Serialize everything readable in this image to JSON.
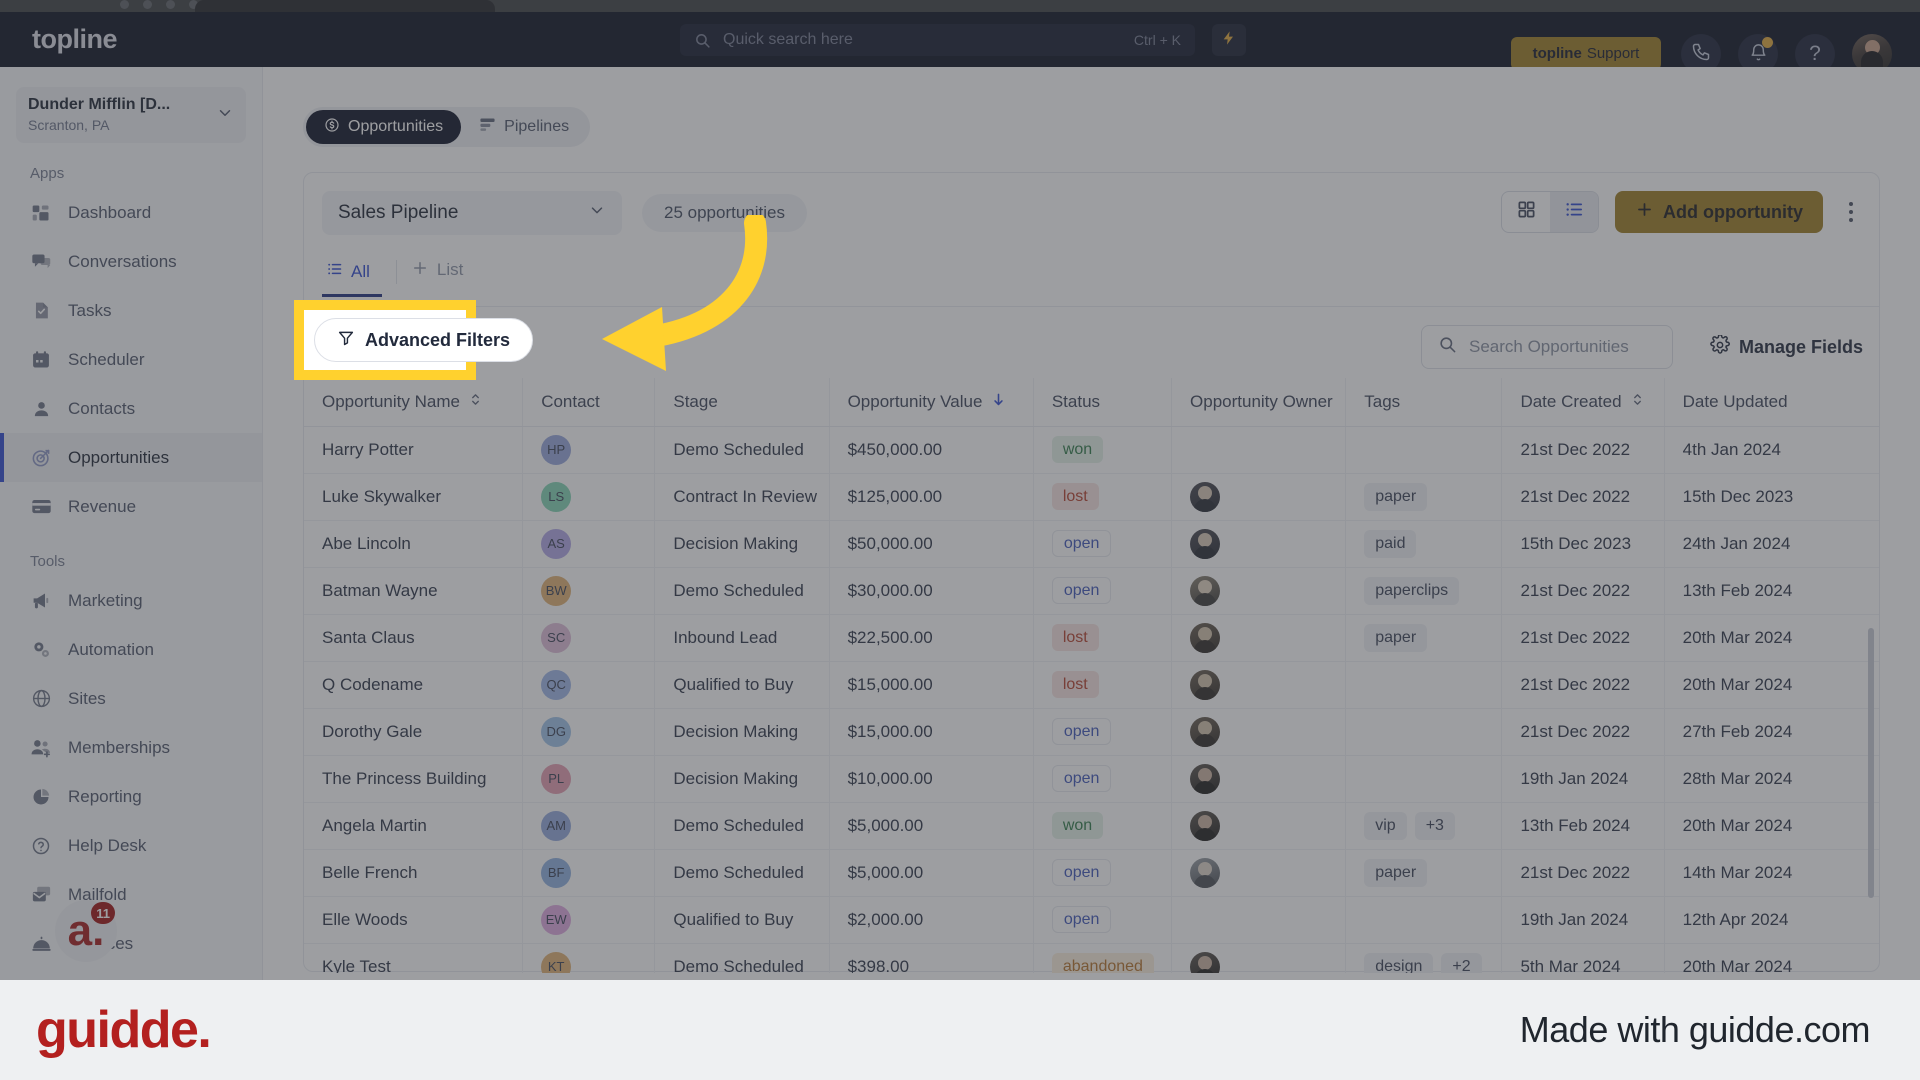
{
  "topbar": {
    "brand": "topline",
    "search_placeholder": "Quick search here",
    "search_shortcut": "Ctrl + K",
    "bolt_icon": "lightning-bolt-icon",
    "support_brand": "topline",
    "support_label": "Support",
    "phone_icon": "phone-icon",
    "bell_icon": "bell-icon",
    "help_icon": "?",
    "avatar": "user-avatar"
  },
  "sidebar": {
    "workspace_name": "Dunder Mifflin [D...",
    "workspace_location": "Scranton, PA",
    "apps_label": "Apps",
    "tools_label": "Tools",
    "apps": [
      {
        "label": "Dashboard",
        "icon": "dashboard-icon",
        "active": false
      },
      {
        "label": "Conversations",
        "icon": "chat-icon",
        "active": false
      },
      {
        "label": "Tasks",
        "icon": "task-icon",
        "active": false
      },
      {
        "label": "Scheduler",
        "icon": "calendar-icon",
        "active": false
      },
      {
        "label": "Contacts",
        "icon": "person-icon",
        "active": false
      },
      {
        "label": "Opportunities",
        "icon": "target-icon",
        "active": true
      },
      {
        "label": "Revenue",
        "icon": "card-icon",
        "active": false
      }
    ],
    "tools": [
      {
        "label": "Marketing",
        "icon": "megaphone-icon"
      },
      {
        "label": "Automation",
        "icon": "gears-icon"
      },
      {
        "label": "Sites",
        "icon": "globe-icon"
      },
      {
        "label": "Memberships",
        "icon": "people-add-icon"
      },
      {
        "label": "Reporting",
        "icon": "pie-chart-icon"
      },
      {
        "label": "Help Desk",
        "icon": "question-circle-icon"
      },
      {
        "label": "Mailfold",
        "icon": "mail-stack-icon"
      },
      {
        "label": "Services",
        "icon": "bell-service-icon"
      }
    ],
    "chat_letter": "a.",
    "chat_badge": "11"
  },
  "segmented": {
    "opportunities": "Opportunities",
    "pipelines": "Pipelines"
  },
  "header": {
    "pipeline_name": "Sales Pipeline",
    "opportunity_count": "25 opportunities",
    "add_label": "Add opportunity",
    "grid_view_icon": "grid-view-icon",
    "list_view_icon": "list-view-icon",
    "kebab_icon": "more-vertical-icon"
  },
  "tabs": {
    "all": "All",
    "list": "List"
  },
  "toolbar": {
    "advanced_filters": "Advanced Filters",
    "search_placeholder": "Search Opportunities",
    "manage_fields": "Manage Fields"
  },
  "table": {
    "columns": [
      {
        "label": "Opportunity Name",
        "sort": "both"
      },
      {
        "label": "Contact",
        "sort": "none"
      },
      {
        "label": "Stage",
        "sort": "none"
      },
      {
        "label": "Opportunity Value",
        "sort": "desc"
      },
      {
        "label": "Status",
        "sort": "none"
      },
      {
        "label": "Opportunity Owner",
        "sort": "none"
      },
      {
        "label": "Tags",
        "sort": "none"
      },
      {
        "label": "Date Created",
        "sort": "both"
      },
      {
        "label": "Date Updated",
        "sort": "none"
      }
    ],
    "rows": [
      {
        "name": "Harry Potter",
        "initials": "HP",
        "ini_bg": "#97a7dd",
        "stage": "Demo Scheduled",
        "value": "$450,000.00",
        "status": "won",
        "owner": "",
        "tags": [],
        "created": "21st Dec 2022",
        "updated": "4th Jan 2024"
      },
      {
        "name": "Luke Skywalker",
        "initials": "LS",
        "ini_bg": "#82d5b4",
        "stage": "Contract In Review",
        "value": "$125,000.00",
        "status": "lost",
        "owner": "avatar-1",
        "tags": [
          "paper"
        ],
        "created": "21st Dec 2022",
        "updated": "15th Dec 2023"
      },
      {
        "name": "Abe Lincoln",
        "initials": "AS",
        "ini_bg": "#b0a6e6",
        "stage": "Decision Making",
        "value": "$50,000.00",
        "status": "open",
        "owner": "avatar-1",
        "tags": [
          "paid"
        ],
        "created": "15th Dec 2023",
        "updated": "24th Jan 2024"
      },
      {
        "name": "Batman Wayne",
        "initials": "BW",
        "ini_bg": "#e0b173",
        "stage": "Demo Scheduled",
        "value": "$30,000.00",
        "status": "open",
        "owner": "avatar-2",
        "tags": [
          "paperclips"
        ],
        "created": "21st Dec 2022",
        "updated": "13th Feb 2024"
      },
      {
        "name": "Santa Claus",
        "initials": "SC",
        "ini_bg": "#dfbcd9",
        "stage": "Inbound Lead",
        "value": "$22,500.00",
        "status": "lost",
        "owner": "avatar-3",
        "tags": [
          "paper"
        ],
        "created": "21st Dec 2022",
        "updated": "20th Mar 2024"
      },
      {
        "name": "Q Codename",
        "initials": "QC",
        "ini_bg": "#9fb6e8",
        "stage": "Qualified to Buy",
        "value": "$15,000.00",
        "status": "lost",
        "owner": "avatar-3",
        "tags": [],
        "created": "21st Dec 2022",
        "updated": "20th Mar 2024"
      },
      {
        "name": "Dorothy Gale",
        "initials": "DG",
        "ini_bg": "#9fc3e8",
        "stage": "Decision Making",
        "value": "$15,000.00",
        "status": "open",
        "owner": "avatar-3",
        "tags": [],
        "created": "21st Dec 2022",
        "updated": "27th Feb 2024"
      },
      {
        "name": "The Princess Building",
        "initials": "PL",
        "ini_bg": "#e59db0",
        "stage": "Decision Making",
        "value": "$10,000.00",
        "status": "open",
        "owner": "avatar-4",
        "tags": [],
        "created": "19th Jan 2024",
        "updated": "28th Mar 2024"
      },
      {
        "name": "Angela Martin",
        "initials": "AM",
        "ini_bg": "#93a9dd",
        "stage": "Demo Scheduled",
        "value": "$5,000.00",
        "status": "won",
        "owner": "avatar-4",
        "tags": [
          "vip",
          "+3"
        ],
        "created": "13th Feb 2024",
        "updated": "20th Mar 2024"
      },
      {
        "name": "Belle French",
        "initials": "BF",
        "ini_bg": "#8fb0e0",
        "stage": "Demo Scheduled",
        "value": "$5,000.00",
        "status": "open",
        "owner": "avatar-5",
        "tags": [
          "paper"
        ],
        "created": "21st Dec 2022",
        "updated": "14th Mar 2024"
      },
      {
        "name": "Elle Woods",
        "initials": "EW",
        "ini_bg": "#dfa9e0",
        "stage": "Qualified to Buy",
        "value": "$2,000.00",
        "status": "open",
        "owner": "",
        "tags": [],
        "created": "19th Jan 2024",
        "updated": "12th Apr 2024"
      },
      {
        "name": "Kyle Test",
        "initials": "KT",
        "ini_bg": "#e0b173",
        "stage": "Demo Scheduled",
        "value": "$398.00",
        "status": "abandoned",
        "owner": "avatar-4",
        "tags": [
          "design",
          "+2"
        ],
        "created": "5th Mar 2024",
        "updated": "20th Mar 2024"
      }
    ]
  },
  "footer": {
    "logo": "guidde.",
    "tagline": "Made with guidde.com"
  },
  "colors": {
    "accent_gold": "#9d7d22",
    "highlight_yellow": "#ffd12e",
    "nav_dark": "#0b1020",
    "active_blue": "#2f4ad0",
    "guidde_red": "#b3201f"
  }
}
